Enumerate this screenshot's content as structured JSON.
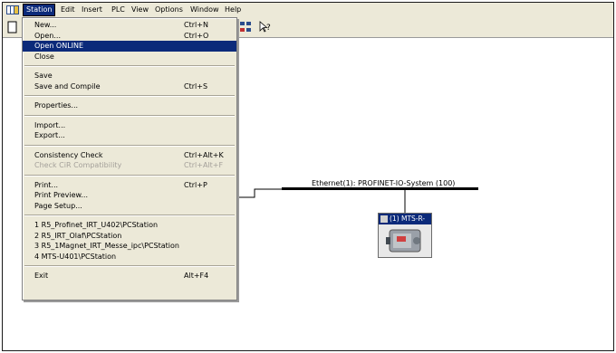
{
  "menubar": {
    "items": [
      "Station",
      "Edit",
      "Insert",
      "PLC",
      "View",
      "Options",
      "Window",
      "Help"
    ]
  },
  "station_menu": {
    "items": [
      {
        "label": "New...",
        "shortcut": "Ctrl+N"
      },
      {
        "label": "Open...",
        "shortcut": "Ctrl+O"
      },
      {
        "label": "Open ONLINE",
        "shortcut": "",
        "selected": true
      },
      {
        "label": "Close",
        "shortcut": ""
      },
      {
        "label": "Save",
        "shortcut": ""
      },
      {
        "label": "Save and Compile",
        "shortcut": "Ctrl+S"
      },
      {
        "label": "Properties...",
        "shortcut": ""
      },
      {
        "label": "Import...",
        "shortcut": ""
      },
      {
        "label": "Export...",
        "shortcut": ""
      },
      {
        "label": "Consistency Check",
        "shortcut": "Ctrl+Alt+K"
      },
      {
        "label": "Check CiR Compatibility",
        "shortcut": "Ctrl+Alt+F",
        "disabled": true
      },
      {
        "label": "Print...",
        "shortcut": "Ctrl+P"
      },
      {
        "label": "Print Preview...",
        "shortcut": ""
      },
      {
        "label": "Page Setup...",
        "shortcut": ""
      },
      {
        "label": "1 R5_Profinet_IRT_U402\\PCStation",
        "shortcut": ""
      },
      {
        "label": "2 R5_IRT_Olaf\\PCStation",
        "shortcut": ""
      },
      {
        "label": "3 R5_1Magnet_IRT_Messe_ipc\\PCStation",
        "shortcut": ""
      },
      {
        "label": "4 MTS-U401\\PCStation",
        "shortcut": ""
      },
      {
        "label": "Exit",
        "shortcut": "Alt+F4"
      }
    ]
  },
  "network": {
    "ethernet_label": "Ethernet(1): PROFINET-IO-System (100)",
    "device_title": "(1) MTS-R-"
  },
  "colors": {
    "menu_bg": "#ece9d8",
    "highlight": "#0b2a7a"
  }
}
